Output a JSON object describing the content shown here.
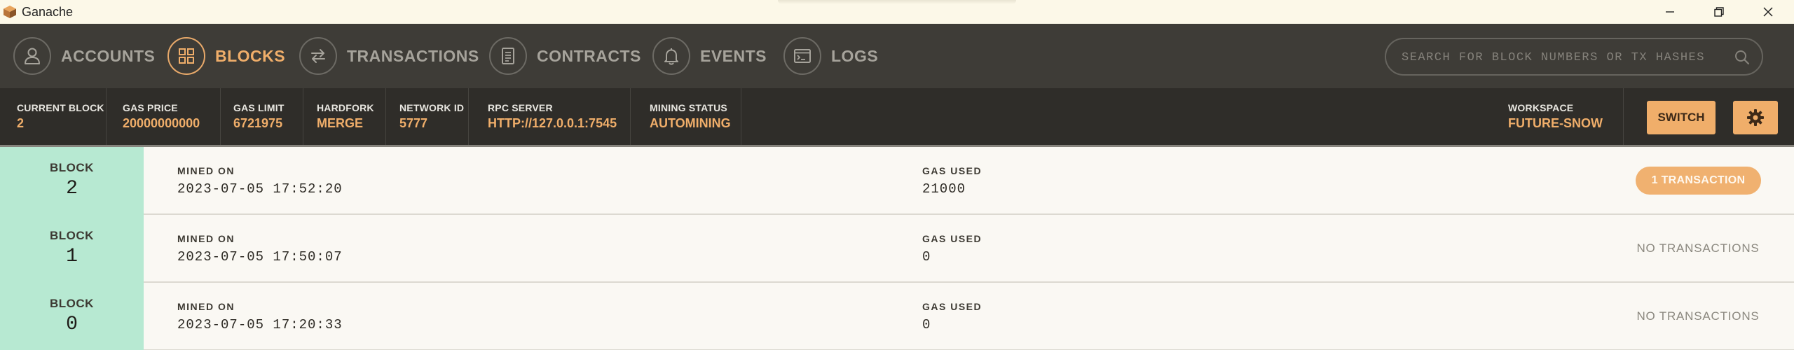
{
  "window": {
    "title": "Ganache",
    "icon": "ganache-cube-icon"
  },
  "nav": {
    "items": [
      {
        "label": "ACCOUNTS",
        "icon": "person-icon",
        "active": false
      },
      {
        "label": "BLOCKS",
        "icon": "grid-icon",
        "active": true
      },
      {
        "label": "TRANSACTIONS",
        "icon": "swap-arrows-icon",
        "active": false
      },
      {
        "label": "CONTRACTS",
        "icon": "document-icon",
        "active": false
      },
      {
        "label": "EVENTS",
        "icon": "bell-icon",
        "active": false
      },
      {
        "label": "LOGS",
        "icon": "terminal-icon",
        "active": false
      }
    ],
    "search": {
      "placeholder": "SEARCH FOR BLOCK NUMBERS OR TX HASHES",
      "value": ""
    }
  },
  "status": {
    "current_block": {
      "label": "CURRENT BLOCK",
      "value": "2"
    },
    "gas_price": {
      "label": "GAS PRICE",
      "value": "20000000000"
    },
    "gas_limit": {
      "label": "GAS LIMIT",
      "value": "6721975"
    },
    "hardfork": {
      "label": "HARDFORK",
      "value": "MERGE"
    },
    "network_id": {
      "label": "NETWORK ID",
      "value": "5777"
    },
    "rpc_server": {
      "label": "RPC SERVER",
      "value": "HTTP://127.0.0.1:7545"
    },
    "mining_status": {
      "label": "MINING STATUS",
      "value": "AUTOMINING"
    },
    "workspace": {
      "label": "WORKSPACE",
      "value": "FUTURE-SNOW"
    },
    "switch_label": "SWITCH"
  },
  "blocks": [
    {
      "label": "BLOCK",
      "number": "2",
      "mined_on_label": "MINED ON",
      "mined_on": "2023-07-05 17:52:20",
      "gas_used_label": "GAS USED",
      "gas_used": "21000",
      "transactions": "1 TRANSACTION",
      "has_tx": true
    },
    {
      "label": "BLOCK",
      "number": "1",
      "mined_on_label": "MINED ON",
      "mined_on": "2023-07-05 17:50:07",
      "gas_used_label": "GAS USED",
      "gas_used": "0",
      "transactions": "NO TRANSACTIONS",
      "has_tx": false
    },
    {
      "label": "BLOCK",
      "number": "0",
      "mined_on_label": "MINED ON",
      "mined_on": "2023-07-05 17:20:33",
      "gas_used_label": "GAS USED",
      "gas_used": "0",
      "transactions": "NO TRANSACTIONS",
      "has_tx": false
    }
  ],
  "colors": {
    "accent": "#f0ae6a",
    "nav_bg": "#3e3c37",
    "status_bg": "#2f2d29",
    "block_badge": "#b7e9d2",
    "row_bg": "#faf8f3"
  }
}
